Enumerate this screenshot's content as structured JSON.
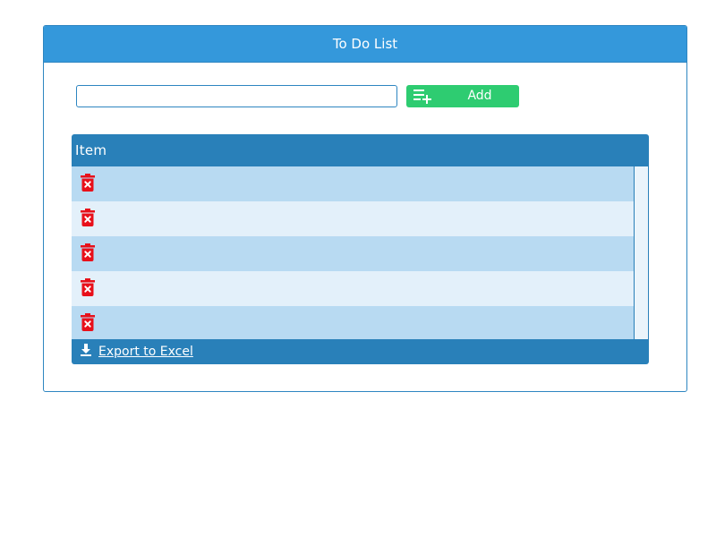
{
  "panel": {
    "title": "To Do List"
  },
  "add_form": {
    "input_value": "",
    "input_placeholder": "",
    "add_label": "Add",
    "add_icon": "playlist-add-icon"
  },
  "grid": {
    "column_header": "Item",
    "rows": [
      {
        "item": "",
        "action_icon": "delete-icon"
      },
      {
        "item": "",
        "action_icon": "delete-icon"
      },
      {
        "item": "",
        "action_icon": "delete-icon"
      },
      {
        "item": "",
        "action_icon": "delete-icon"
      },
      {
        "item": "",
        "action_icon": "delete-icon"
      }
    ],
    "export_label": "Export to Excel",
    "export_icon": "download-icon"
  },
  "colors": {
    "header": "#3498db",
    "grid_header": "#2980b9",
    "add_button": "#2ecc71",
    "row_alt": "#b8daf2",
    "row": "#e3f0fa",
    "delete": "#e8101a"
  }
}
